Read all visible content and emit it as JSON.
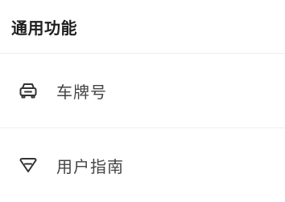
{
  "section": {
    "title": "通用功能"
  },
  "menu": {
    "items": [
      {
        "label": "车牌号",
        "icon": "car-icon"
      },
      {
        "label": "用户指南",
        "icon": "guide-shield-icon"
      }
    ]
  }
}
